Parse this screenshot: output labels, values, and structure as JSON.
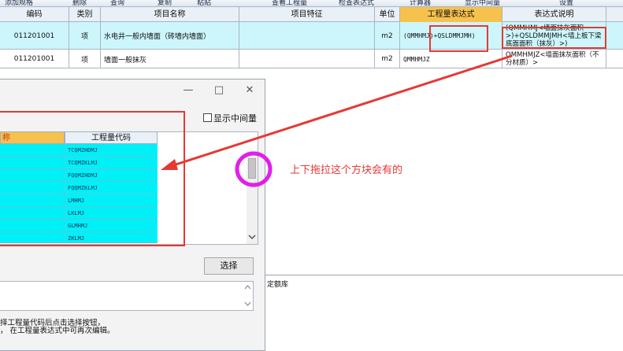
{
  "toolbar": {
    "items": [
      "添加规格",
      "删除",
      "查询",
      "复制",
      "粘贴",
      "查看工程量",
      "检查表达式",
      "计算器",
      "显示中间量",
      "设置"
    ]
  },
  "grid": {
    "columns": [
      "编码",
      "类别",
      "项目名称",
      "项目特征",
      "单位",
      "工程量表达式",
      "表达式说明"
    ],
    "rows": [
      {
        "code": "011201001",
        "type": "项",
        "name": "水电井一般内墙面（砖墙内墙面）",
        "feature": "",
        "unit": "m2",
        "expression": "(QMMHMJ)+QSLDMMJMH)",
        "description": "(QMMHMJ<墙面抹灰面积>)+QSLDMMJMH<墙上板下梁底面面积（抹灰）>)"
      },
      {
        "code": "011201001",
        "type": "项",
        "name": "墙面一般抹灰",
        "feature": "",
        "unit": "m2",
        "expression": "QMMHMJZ",
        "description": "QMMHMJZ<墙面抹灰面积（不分材质）>"
      }
    ]
  },
  "dialog": {
    "minimize": "—",
    "maximize": "□",
    "close": "✕",
    "show_intermediate_label": "显示中间量",
    "col_name": "称",
    "col_code": "工程量代码",
    "codes": [
      "TCQMZHDMJ",
      "TCQMZKLMJ",
      "FQQMZHDMJ",
      "FQQMZKLMJ",
      "LMHMJ",
      "LKLMJ",
      "GLMHMJ",
      "ZKLMJ"
    ],
    "select_button": "选择",
    "hint_line1": "择工程量代码后点击选择按钮，",
    "hint_line2": "，  在工程量表达式中可再次编辑。"
  },
  "annotation": {
    "text": "上下拖拉这个方块会有的"
  },
  "bottom_panel": {
    "label": "定额库"
  },
  "colors": {
    "cyan_row": "#00f0f8",
    "selected_row": "#ccf6fb",
    "annotation_red": "#e53935",
    "circle_magenta": "#e020e8",
    "expr_header": "#f6c14d"
  }
}
